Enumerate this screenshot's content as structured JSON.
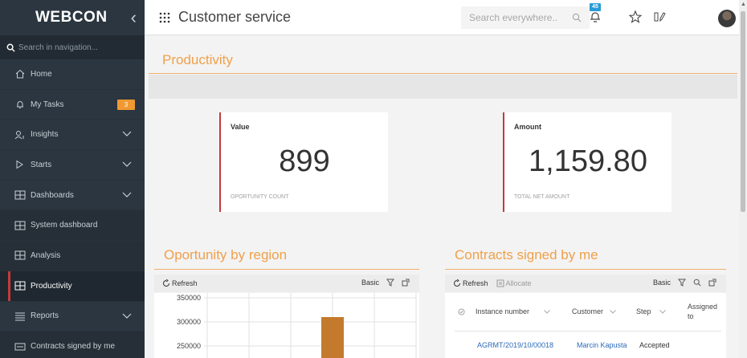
{
  "sidebar": {
    "logo": "WEBCON",
    "search_placeholder": "Search in navigation...",
    "items": [
      {
        "label": "Home",
        "icon": "home-icon"
      },
      {
        "label": "My Tasks",
        "icon": "bell-icon",
        "badge": "3"
      },
      {
        "label": "Insights",
        "icon": "insights-icon"
      },
      {
        "label": "Starts",
        "icon": "play-icon"
      },
      {
        "label": "Dashboards",
        "icon": "dashboard-icon"
      },
      {
        "label": "System dashboard",
        "icon": "dashboard-icon"
      },
      {
        "label": "Analysis",
        "icon": "dashboard-icon"
      },
      {
        "label": "Productivity",
        "icon": "dashboard-icon"
      },
      {
        "label": "Reports",
        "icon": "reports-icon"
      },
      {
        "label": "Contracts signed by me",
        "icon": "report-icon"
      }
    ]
  },
  "header": {
    "title": "Customer service",
    "search_placeholder": "Search everywhere..",
    "notification_count": "45"
  },
  "main": {
    "title": "Productivity",
    "kpis": [
      {
        "label": "Value",
        "value": "899",
        "sub": "OPORTUNITY COUNT"
      },
      {
        "label": "Amount",
        "value": "1,159.80",
        "sub": "TOTAL NET AMOUNT"
      }
    ]
  },
  "chart_panel": {
    "title": "Oportunity by region",
    "refresh_label": "Refresh",
    "view_label": "Basic"
  },
  "chart_data": {
    "type": "bar",
    "title": "",
    "xlabel": "",
    "ylabel": "",
    "y_ticks": [
      "350000",
      "300000",
      "250000"
    ],
    "ylim": [
      225000,
      350000
    ],
    "visible_bars": [
      {
        "column": 3,
        "value": 310000
      }
    ],
    "columns": 5,
    "grid": true,
    "bar_color": "#c47a2c"
  },
  "table_panel": {
    "title": "Contracts signed by me",
    "refresh_label": "Refresh",
    "allocate_label": "Allocate",
    "view_label": "Basic",
    "columns": [
      "Instance number",
      "Customer",
      "Step",
      "Assigned to"
    ],
    "rows": [
      {
        "instance": "AGRMT/2019/10/00018",
        "customer": "Marcin Kapusta",
        "step": "Accepted"
      }
    ]
  },
  "colors": {
    "accent_orange": "#f0a04a",
    "kpi_border_red": "#c23b3b",
    "sidebar_bg": "#2b3640",
    "link_blue": "#2a6ab8",
    "badge_orange": "#f09932",
    "notif_blue": "#2a9bd6"
  }
}
